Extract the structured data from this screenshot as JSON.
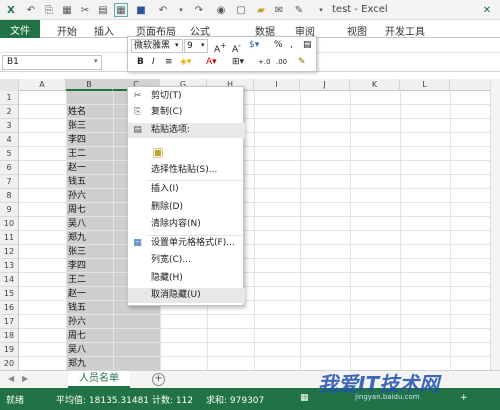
{
  "window": {
    "title": "test - Excel"
  },
  "ribbon_tabs": [
    "文件",
    "开始",
    "插入",
    "页面布局",
    "公式",
    "数据",
    "审阅",
    "视图",
    "开发工具"
  ],
  "name_box": "B1",
  "columns": [
    "A",
    "B",
    "C",
    "G",
    "H",
    "I",
    "J",
    "K",
    "L"
  ],
  "rows": [
    "1",
    "2",
    "3",
    "4",
    "5",
    "6",
    "7",
    "8",
    "9",
    "10",
    "11",
    "12",
    "13",
    "14",
    "15",
    "16",
    "17",
    "18",
    "19",
    "20"
  ],
  "cells_b": [
    "",
    "姓名",
    "张三",
    "李四",
    "王二",
    "赵一",
    "钱五",
    "孙六",
    "周七",
    "吴八",
    "郑九",
    "张三",
    "李四",
    "王二",
    "赵一",
    "钱五",
    "孙六",
    "周七",
    "吴八",
    "郑九"
  ],
  "mini_toolbar": {
    "font_name": "微软雅黑",
    "font_size": "9",
    "bold": "B",
    "italic": "I",
    "percent": "%",
    "comma": ","
  },
  "context_menu": [
    {
      "label": "剪切(T)",
      "icon": "scissors-icon"
    },
    {
      "label": "复制(C)",
      "icon": "copy-icon"
    },
    {
      "label": "粘贴选项:",
      "icon": "paste-icon"
    },
    {
      "label": "",
      "icon": "clipboard-paste-icon"
    },
    {
      "label": "选择性粘贴(S)...",
      "icon": ""
    },
    {
      "label": "插入(I)",
      "icon": ""
    },
    {
      "label": "删除(D)",
      "icon": ""
    },
    {
      "label": "清除内容(N)",
      "icon": ""
    },
    {
      "label": "设置单元格格式(F)...",
      "icon": "format-cells-icon"
    },
    {
      "label": "列宽(C)...",
      "icon": ""
    },
    {
      "label": "隐藏(H)",
      "icon": ""
    },
    {
      "label": "取消隐藏(U)",
      "icon": ""
    }
  ],
  "sheet_tab": "人员名单",
  "status": {
    "ready": "就绪",
    "average": "平均值: 18135.31481",
    "count": "计数: 112",
    "sum": "求和: 979307"
  },
  "watermark": {
    "main": "我爱IT技术网",
    "sub": "jingyan.baidu.com"
  },
  "colors": {
    "excel_green": "#217346",
    "selected_col": "#cfcfcf",
    "menu_hover": "#e8e8e8"
  }
}
